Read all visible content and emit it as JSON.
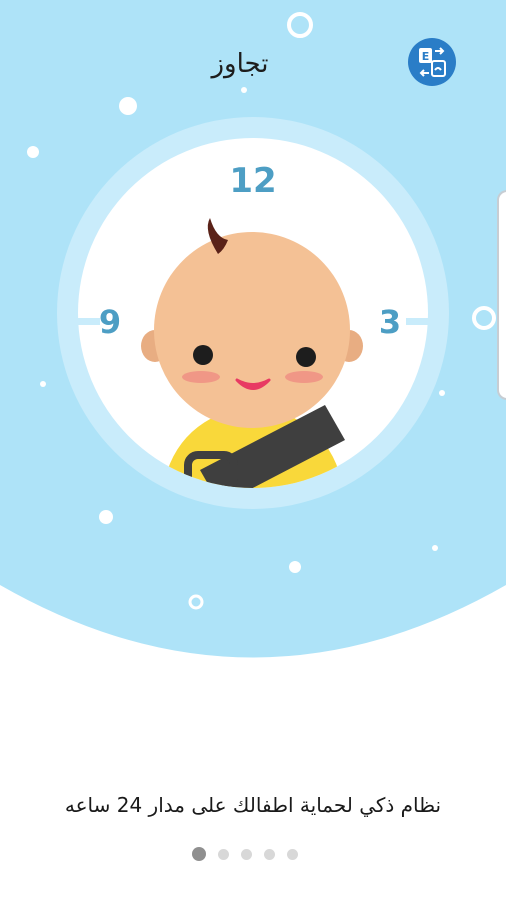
{
  "header": {
    "skip_label": "تجاوز",
    "language_icon": "language-switch-icon"
  },
  "hero": {
    "clock_numbers": [
      "12",
      "3",
      "9"
    ],
    "illustration": "baby-in-car-seat"
  },
  "tagline": "نظام ذكي لحماية اطفالك على مدار 24 ساعه",
  "pager": {
    "total": 5,
    "active_index": 0
  },
  "colors": {
    "sky": "#aee3f8",
    "clock_ring": "#c9ecfb",
    "clock_numbers": "#4d9ec4",
    "skin": "#f4c195",
    "shirt": "#f9d83a",
    "strap": "#3f3f3f",
    "accent_button": "#2a7dc7"
  }
}
